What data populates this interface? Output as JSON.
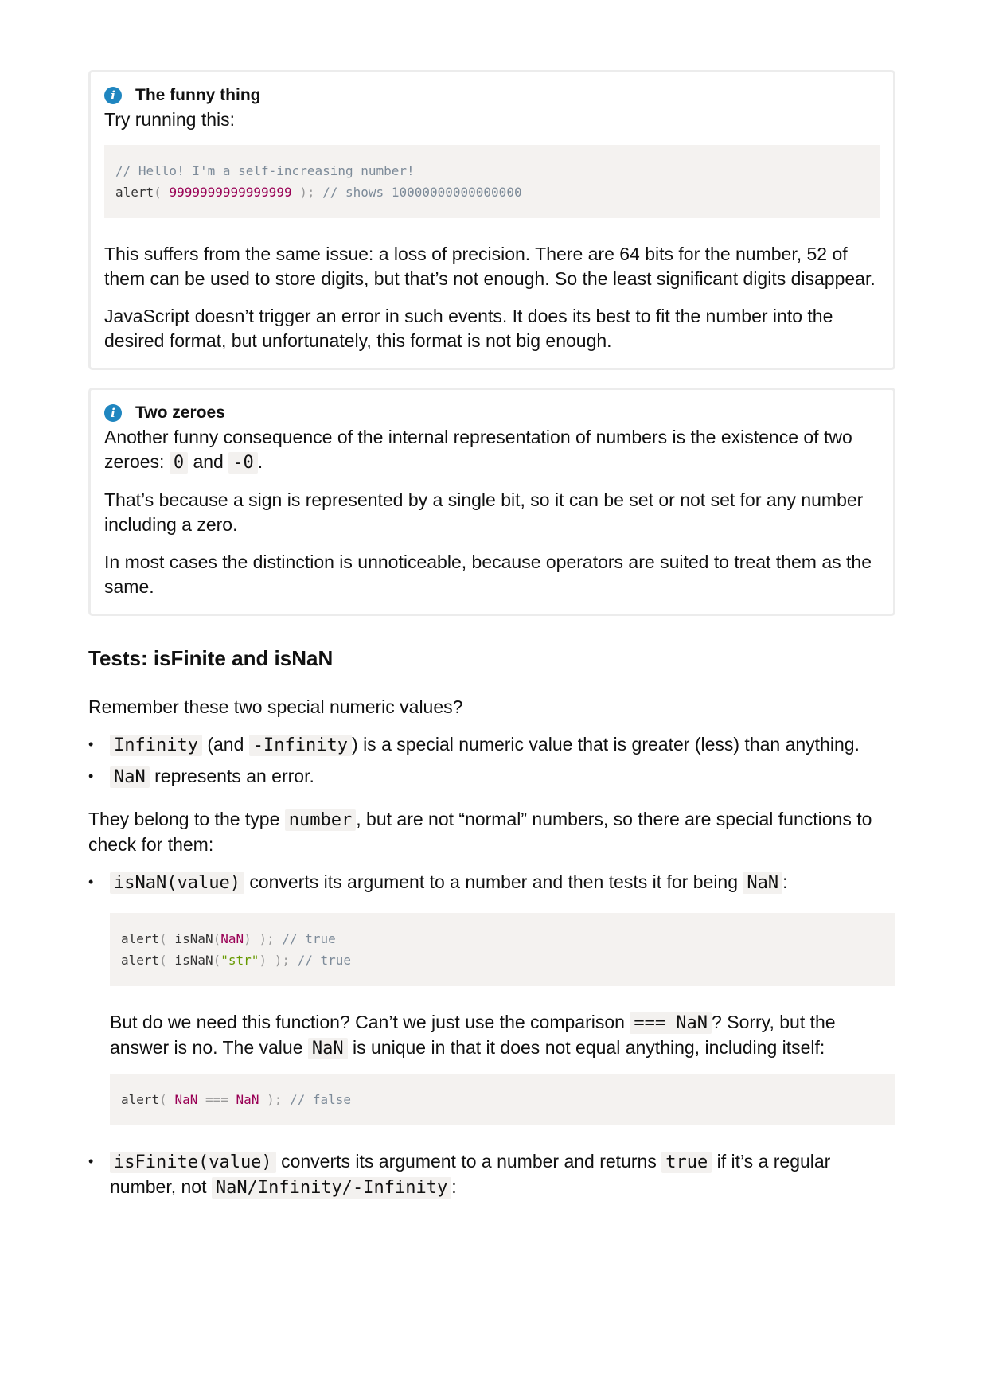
{
  "note1": {
    "title": "The funny thing",
    "intro": "Try running this:",
    "code_line1": "// Hello! I'm a self-increasing number!",
    "code_line2": {
      "fn": "alert",
      "open": "(",
      "num": "9999999999999999",
      "close": ");",
      "comment": "// shows 10000000000000000"
    },
    "para1": "This suffers from the same issue: a loss of precision. There are 64 bits for the number, 52 of them can be used to store digits, but that’s not enough. So the least significant digits disappear.",
    "para2": "JavaScript doesn’t trigger an error in such events. It does its best to fit the number into the desired format, but unfortunately, this format is not big enough."
  },
  "note2": {
    "title": "Two zeroes",
    "para1_a": "Another funny consequence of the internal representation of numbers is the existence of two zeroes: ",
    "zero": "0",
    "para1_and": " and ",
    "neg_zero": "-0",
    "para1_end": ".",
    "para2": "That’s because a sign is represented by a single bit, so it can be set or not set for any number including a zero.",
    "para3": "In most cases the distinction is unnoticeable, because operators are suited to treat them as the same."
  },
  "section": {
    "heading": "Tests: isFinite and isNaN",
    "intro": "Remember these two special numeric values?",
    "bullet1": {
      "code1": "Infinity",
      "t1": " (and ",
      "code2": "-Infinity",
      "t2": ") is a special numeric value that is greater (less) than anything."
    },
    "bullet2": {
      "code": "NaN",
      "t": " represents an error."
    },
    "para_a": "They belong to the type ",
    "para_code": "number",
    "para_b": ", but are not “normal” numbers, so there are special functions to check for them:",
    "isnan": {
      "code": "isNaN(value)",
      "t": " converts its argument to a number and then tests it for being ",
      "code2": "NaN",
      "end": ":",
      "ex1": {
        "fn": "alert",
        "open": "(",
        "call": "isNaN",
        "p1": "(",
        "arg": "NaN",
        "p2": ")",
        "close": ");",
        "comment": "// true"
      },
      "ex2": {
        "fn": "alert",
        "open": "(",
        "call": "isNaN",
        "p1": "(",
        "arg": "\"str\"",
        "p2": ")",
        "close": ");",
        "comment": "// true"
      },
      "follow_a": "But do we need this function? Can’t we just use the comparison ",
      "follow_code": "=== NaN",
      "follow_b": "? Sorry, but the answer is no. The value ",
      "follow_code2": "NaN",
      "follow_c": " is unique in that it does not equal anything, including itself:",
      "ex3": {
        "fn": "alert",
        "open": "(",
        "a": "NaN",
        "op": "===",
        "b": "NaN",
        "close": ");",
        "comment": "// false"
      }
    },
    "isfinite": {
      "code": "isFinite(value)",
      "t": " converts its argument to a number and returns ",
      "code2": "true",
      "t2": " if it’s a regular number, not ",
      "code3": "NaN/Infinity/-Infinity",
      "end": ":"
    }
  }
}
